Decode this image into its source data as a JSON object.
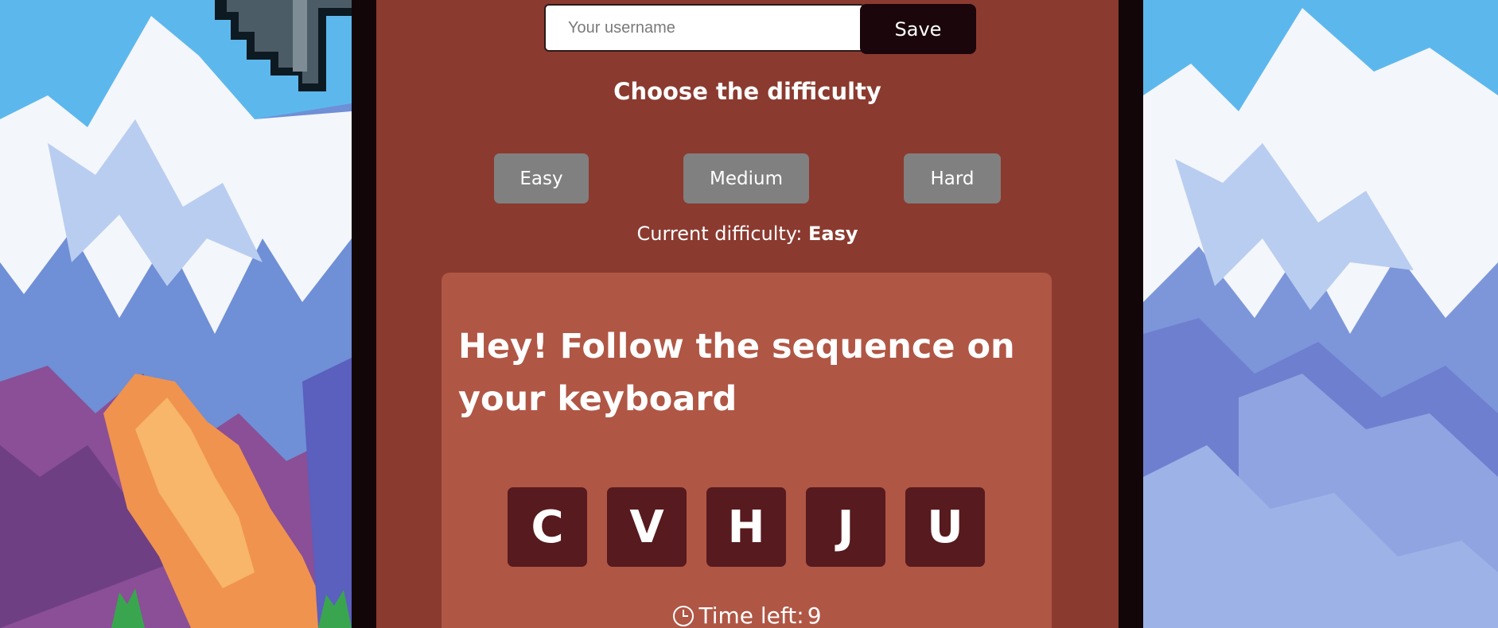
{
  "username": {
    "placeholder": "Your username",
    "value": ""
  },
  "save_label": "Save",
  "difficulty": {
    "heading": "Choose the difficulty",
    "options": [
      "Easy",
      "Medium",
      "Hard"
    ],
    "current_label": "Current difficulty: ",
    "current_value": "Easy"
  },
  "game": {
    "title": "Hey! Follow the sequence on your keyboard",
    "sequence": [
      "C",
      "V",
      "H",
      "J",
      "U"
    ],
    "timer_label": "Time left: ",
    "time_left": "9",
    "timer_icon": "clock-icon"
  },
  "colors": {
    "panel": "#8b3a2f",
    "frame": "#120609",
    "card": "#b05645",
    "key": "#571a1e",
    "difficulty_button": "#808080",
    "save_button": "#1a060b"
  }
}
